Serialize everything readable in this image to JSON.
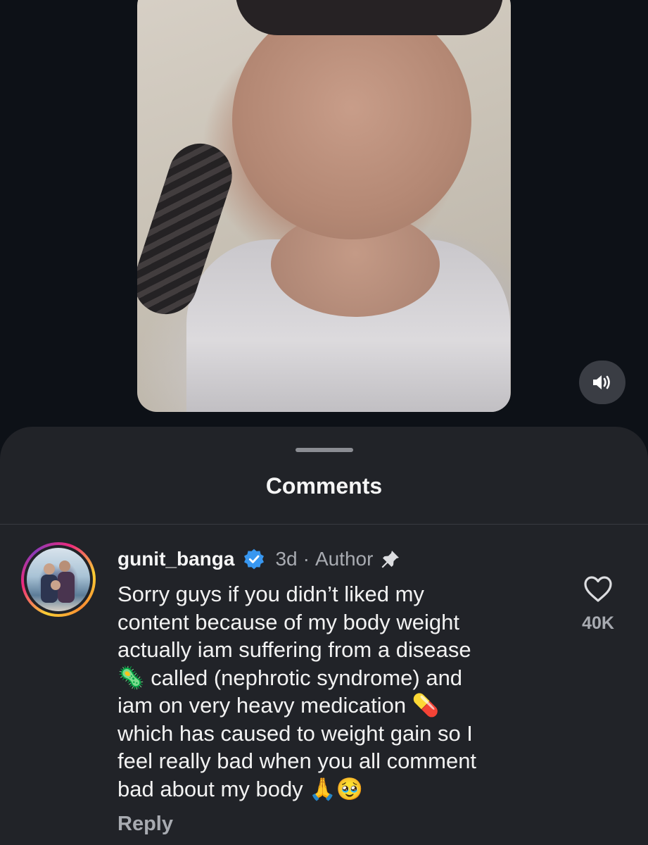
{
  "video": {
    "description_icon": "sound-on-icon"
  },
  "sheet": {
    "title": "Comments"
  },
  "comment": {
    "username": "gunit_banga",
    "time": "3d",
    "separator": "·",
    "role": "Author",
    "text": "Sorry guys if you didn’t liked my\ncontent because of my body weight\nactually iam suffering from a disease\n🦠 called (nephrotic syndrome) and\niam on very heavy medication 💊\nwhich has caused to weight gain so I\nfeel really bad when you all comment\nbad about my body 🙏🥹",
    "reply_label": "Reply",
    "like_count": "40K",
    "verified": true,
    "pinned": true
  },
  "colors": {
    "background": "#0d1117",
    "sheet": "#212328",
    "verified_badge": "#3897f0",
    "muted_text": "#a8abb1"
  }
}
